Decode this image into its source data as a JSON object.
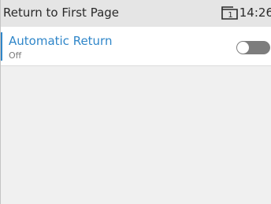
{
  "header": {
    "title": "Return to First Page",
    "line_icon": "phone-line-1-icon",
    "line_number": "1",
    "time": "14:26"
  },
  "settings": {
    "items": [
      {
        "label": "Automatic Return",
        "value": "Off",
        "toggle_on": false
      }
    ]
  },
  "colors": {
    "accent": "#2f86c9",
    "toggle_off": "#7d7d7d",
    "header_bg": "#e5e5e5",
    "list_bg": "#f0f0f0"
  }
}
